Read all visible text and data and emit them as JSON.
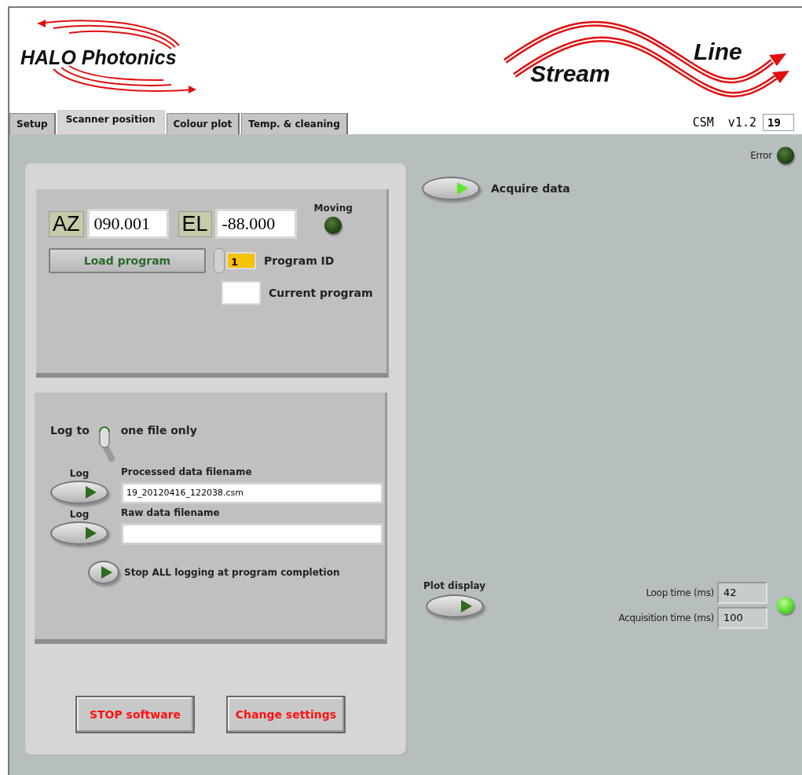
{
  "header": {
    "left_logo": {
      "text": "HALO Photonics"
    },
    "right_logo": {
      "word_1": "Stream",
      "word_2": "Line"
    }
  },
  "tabs": [
    {
      "label": "Setup",
      "selected": false
    },
    {
      "label": "Scanner position",
      "selected": true
    },
    {
      "label": "Colour plot",
      "selected": false
    },
    {
      "label": "Temp. & cleaning",
      "selected": false
    }
  ],
  "version": {
    "label": "CSM  v1.2",
    "value": "19"
  },
  "error_indicator": {
    "label": "Error",
    "on": false
  },
  "position": {
    "az_label": "AZ",
    "az_value": "090.001",
    "el_label": "EL",
    "el_value": "-88.000",
    "moving_label": "Moving",
    "moving_on": false
  },
  "program": {
    "load_button": "Load program",
    "id_value": "1",
    "id_label": "Program ID",
    "current_label": "Current program"
  },
  "logging": {
    "log_to_label": "Log to",
    "switch_on": true,
    "switch_label": "one file only",
    "files": [
      {
        "button_label": "Log",
        "on": false,
        "field_label": "Processed data filename",
        "value": "19_20120416_122038.csm"
      },
      {
        "button_label": "Log",
        "on": false,
        "field_label": "Raw data filename"
      }
    ],
    "stop_all": {
      "label": "Stop ALL logging at program completion",
      "on": false
    }
  },
  "buttons": [
    {
      "label": "STOP software"
    },
    {
      "label": "Change settings"
    }
  ],
  "acquire": {
    "label": "Acquire data",
    "on": true
  },
  "plot_display": {
    "label": "Plot display",
    "on": false
  },
  "timing": [
    {
      "label": "Loop time (ms)",
      "value": "42"
    },
    {
      "label": "Acquisition time (ms)",
      "value": "100"
    }
  ],
  "status_led": {
    "on": true
  }
}
